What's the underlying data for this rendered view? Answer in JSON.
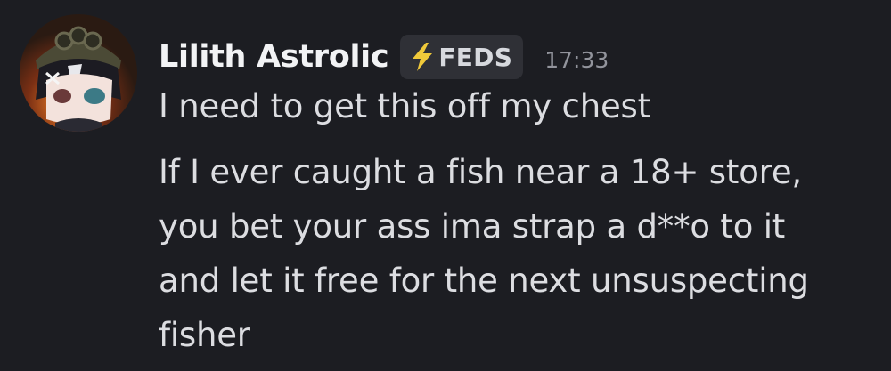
{
  "message": {
    "author": {
      "name": "Lilith Astrolic",
      "tag": {
        "icon": "lightning-bolt-icon",
        "label": "FEDS",
        "icon_color": "#f0c93a"
      },
      "avatar": "avatar-image"
    },
    "timestamp": "17:33",
    "first_line": "I need to get this off my chest",
    "second_message_lines": [
      "If I ever caught a fish near a 18+ store,",
      "you bet your ass ima strap a d**o to it",
      "and let it free for the next unsuspecting",
      "fisher"
    ]
  },
  "colors": {
    "background": "#1c1d22",
    "username": "#f2f3f5",
    "text": "#dcdde1",
    "timestamp": "#92949c",
    "tag_background": "#2f3036"
  }
}
